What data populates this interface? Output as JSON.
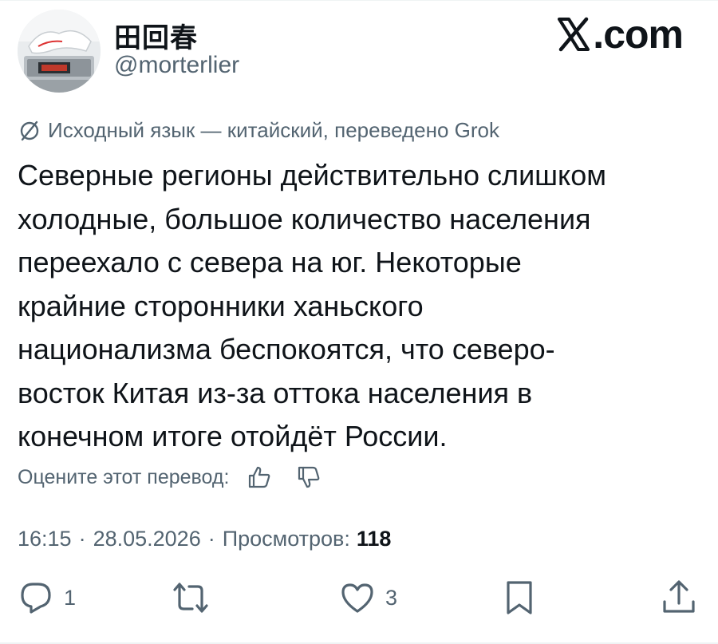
{
  "user": {
    "display_name": "田回春",
    "handle": "@morterlier"
  },
  "brand": {
    "text": ".com",
    "icon": "x-logo-icon"
  },
  "translation": {
    "icon": "translate-icon",
    "source_text": "Исходный язык — китайский, переведено Grok"
  },
  "tweet": {
    "text": "Северные регионы действительно слишком\nхолодные, большое количество населения\nпереехало с севера на юг. Некоторые\nкрайние сторонники ханьского\nнационализма беспокоятся, что северо-\nвосток Китая из-за оттока населения в\nконечном итоге отойдёт России."
  },
  "rating": {
    "label": "Оцените этот перевод:",
    "thumb_up_icon": "thumbs-up-icon",
    "thumb_down_icon": "thumbs-down-icon"
  },
  "meta": {
    "time": "16:15",
    "date": "28.05.2026",
    "separator": "·",
    "views_label": "Просмотров:",
    "views_count": "118"
  },
  "actions": {
    "reply_count": "1",
    "repost_count": "",
    "like_count": "3"
  },
  "colors": {
    "text": "#0f1419",
    "secondary": "#536471",
    "divider": "#eff3f4"
  }
}
